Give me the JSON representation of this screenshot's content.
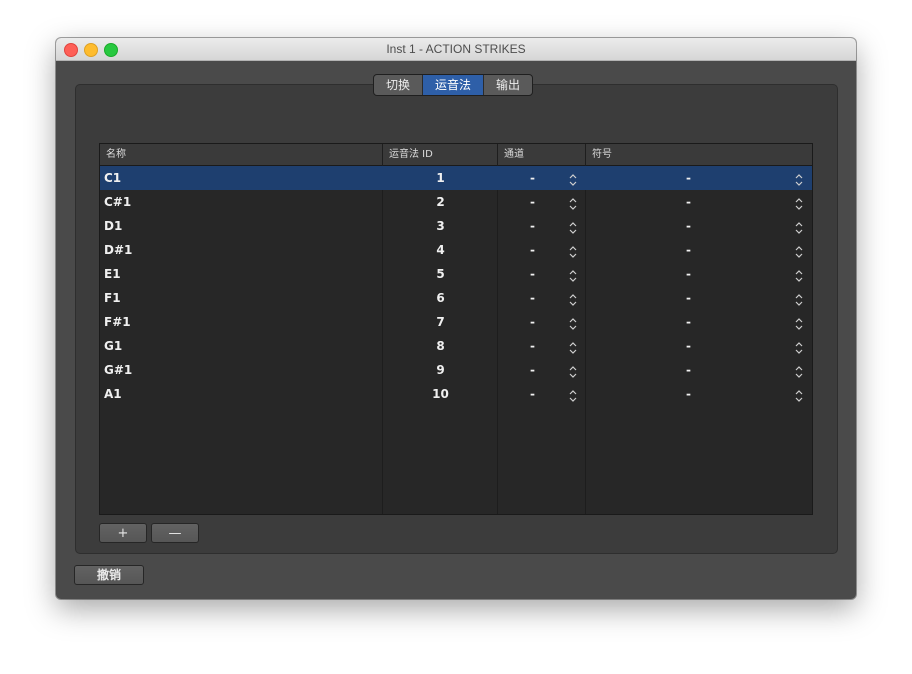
{
  "window": {
    "title": "Inst 1 - ACTION STRIKES"
  },
  "tabs": [
    {
      "label": "切换",
      "active": false
    },
    {
      "label": "运音法",
      "active": true
    },
    {
      "label": "输出",
      "active": false
    }
  ],
  "table": {
    "columns": [
      "名称",
      "运音法 ID",
      "通道",
      "符号"
    ],
    "rows": [
      {
        "name": "C1",
        "id": "1",
        "channel": "-",
        "symbol": "-",
        "selected": true
      },
      {
        "name": "C#1",
        "id": "2",
        "channel": "-",
        "symbol": "-"
      },
      {
        "name": "D1",
        "id": "3",
        "channel": "-",
        "symbol": "-"
      },
      {
        "name": "D#1",
        "id": "4",
        "channel": "-",
        "symbol": "-"
      },
      {
        "name": "E1",
        "id": "5",
        "channel": "-",
        "symbol": "-"
      },
      {
        "name": "F1",
        "id": "6",
        "channel": "-",
        "symbol": "-"
      },
      {
        "name": "F#1",
        "id": "7",
        "channel": "-",
        "symbol": "-"
      },
      {
        "name": "G1",
        "id": "8",
        "channel": "-",
        "symbol": "-"
      },
      {
        "name": "G#1",
        "id": "9",
        "channel": "-",
        "symbol": "-"
      },
      {
        "name": "A1",
        "id": "10",
        "channel": "-",
        "symbol": "-"
      }
    ]
  },
  "buttons": {
    "add": "+",
    "remove": "—",
    "undo": "撤销"
  },
  "colors": {
    "selection": "#1e3f6f",
    "active_tab": "#2e5fa8"
  },
  "icons": {
    "stepper": "up-down-stepper-icon"
  }
}
